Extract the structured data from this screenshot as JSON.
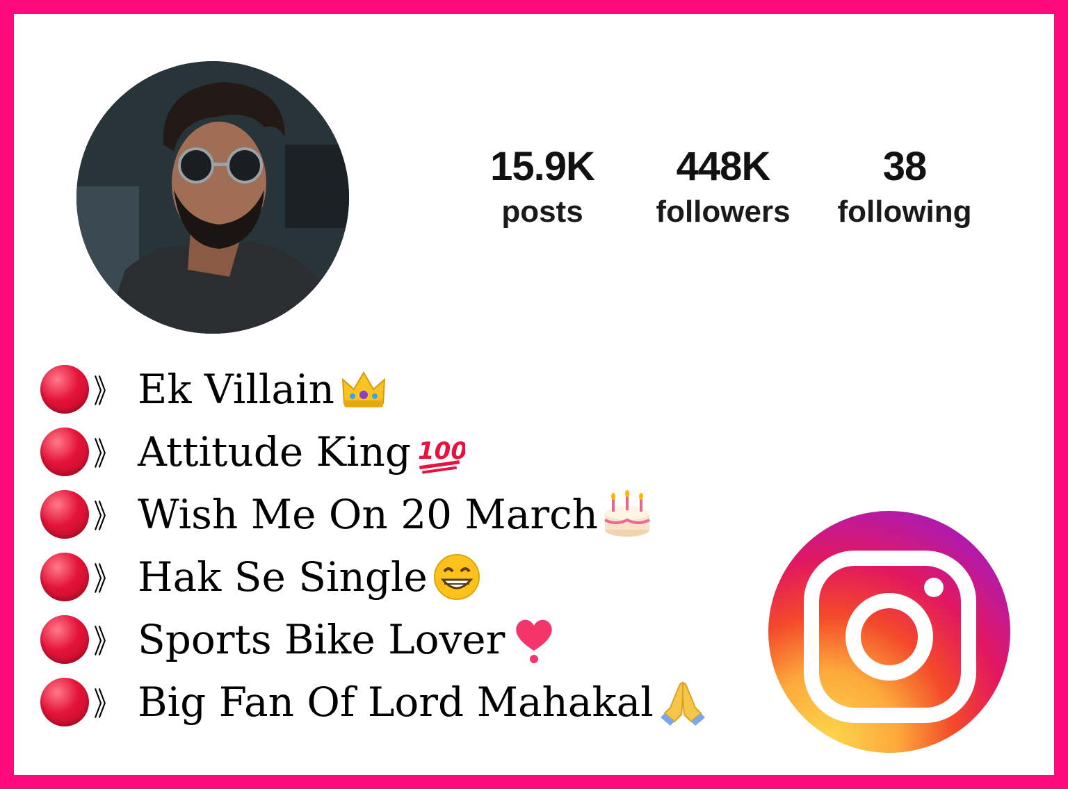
{
  "profile": {
    "stats": [
      {
        "value": "15.9K",
        "label": "posts"
      },
      {
        "value": "448K",
        "label": "followers"
      },
      {
        "value": "38",
        "label": "following"
      }
    ]
  },
  "bio": {
    "lines": [
      {
        "text": "Ek Villain",
        "emoji": "crown-icon"
      },
      {
        "text": "Attitude King ",
        "emoji": "hundred-points-icon"
      },
      {
        "text": "Wish Me On 20 March",
        "emoji": "birthday-cake-icon"
      },
      {
        "text": "Hak Se Single ",
        "emoji": "grinning-face-icon"
      },
      {
        "text": "Sports Bike Lover",
        "emoji": "heart-exclamation-icon"
      },
      {
        "text": "Big Fan Of Lord Mahakal ",
        "emoji": "folded-hands-icon"
      }
    ],
    "bullet_glyph": "》"
  },
  "colors": {
    "frame": "#ff0a7d",
    "bullet": "#e4133a"
  }
}
